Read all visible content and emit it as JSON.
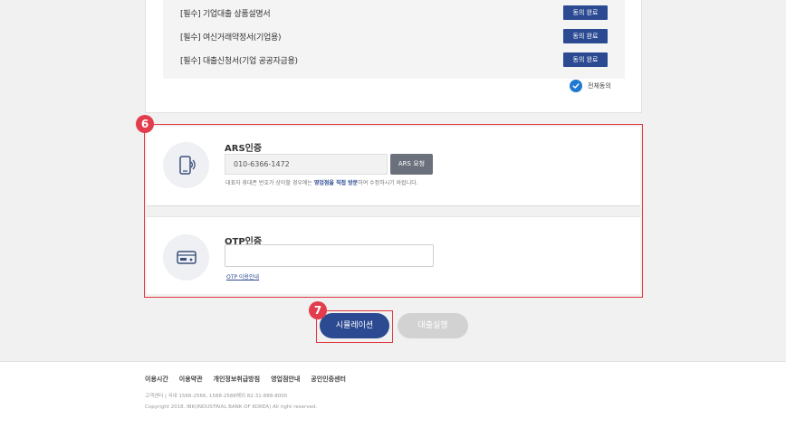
{
  "agreements": {
    "items": [
      {
        "label": "[필수] 기업대출 상품설명서",
        "button": "동의 완료"
      },
      {
        "label": "[필수] 여신거래약정서(기업용)",
        "button": "동의 완료"
      },
      {
        "label": "[필수] 대출신청서(기업 공공자금용)",
        "button": "동의 완료"
      }
    ],
    "all_agree_label": "전체동의",
    "all_agree_checked": true
  },
  "badges": {
    "auth": "6",
    "simulate": "7"
  },
  "ars": {
    "title": "ARS인증",
    "phone_value": "010-6366-1472",
    "request_button": "ARS 요청",
    "notice_before": "대표자 휴대폰 번호가 상이할 경우에는 ",
    "notice_link": "영업점을 직접 방문",
    "notice_after": "하여 수정하시기 바랍니다.",
    "icon": "phone-icon"
  },
  "otp": {
    "title": "OTP인증",
    "input_value": "",
    "guide_link": "OTP 이용안내",
    "icon": "otp-card-icon"
  },
  "actions": {
    "simulate_label": "시뮬레이션",
    "execute_label": "대출실행"
  },
  "footer": {
    "links": [
      "이용시간",
      "이용약관",
      "개인정보취급방침",
      "영업점안내",
      "공인인증센터"
    ],
    "contact": "고객센터  |  국내 1566-2566, 1588-2588해외 82-31-888-8000",
    "copyright": "Copyright 2018. IBK(INDUSTRIAL BANK OF KOREA) All right reserved."
  },
  "colors": {
    "primary": "#2c4a92",
    "highlight": "#e0383e",
    "check": "#1f78d1"
  }
}
